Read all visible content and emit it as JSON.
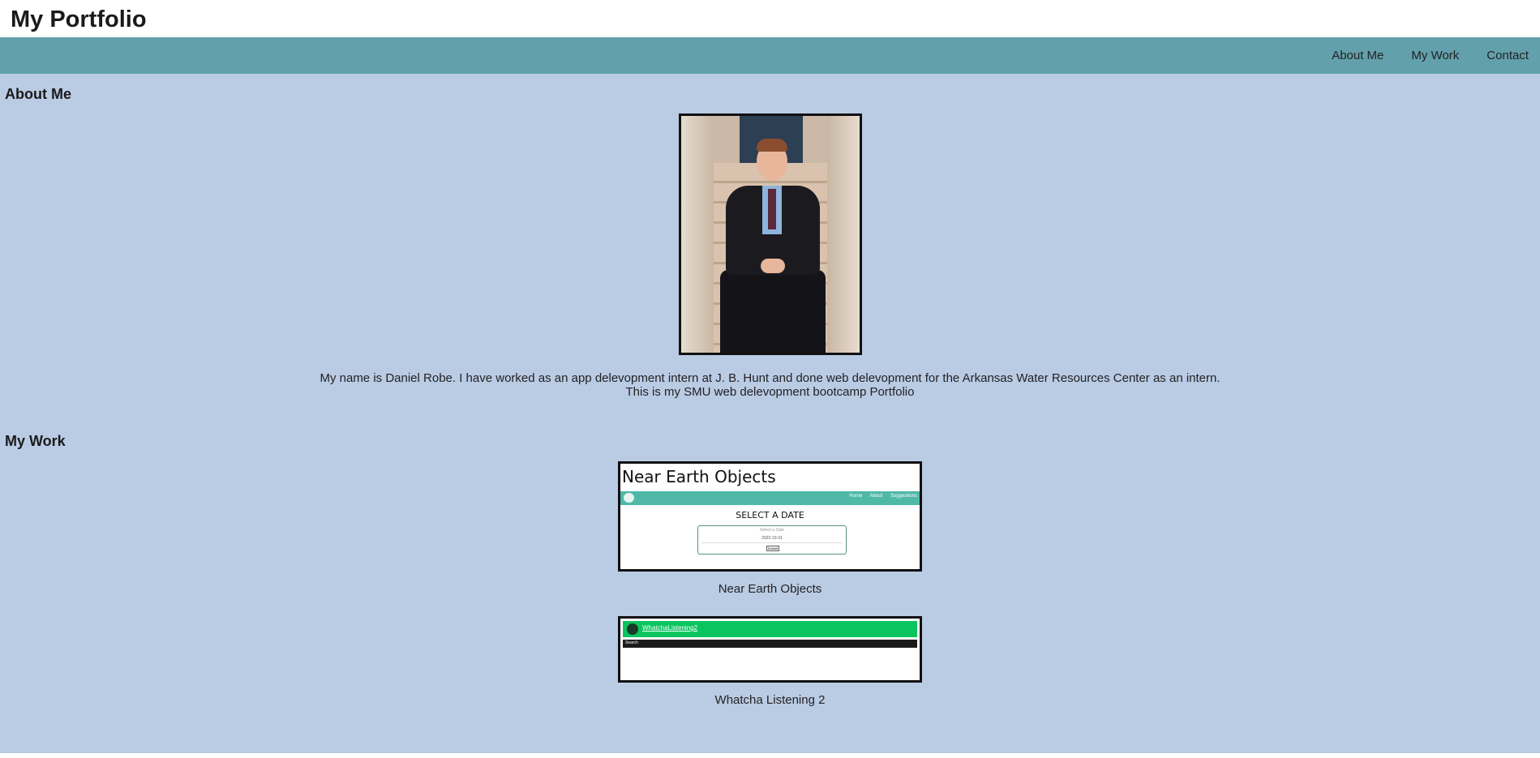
{
  "header": {
    "title": "My Portfolio"
  },
  "nav": {
    "items": [
      {
        "label": "About Me"
      },
      {
        "label": "My Work"
      },
      {
        "label": "Contact"
      }
    ]
  },
  "about": {
    "heading": "About Me",
    "text_line1": "My name is Daniel Robe. I have worked as an app delevopment intern at J. B. Hunt and done web delevopment for the Arkansas Water Resources Center as an intern.",
    "text_line2": "This is my SMU web delevopment bootcamp Portfolio"
  },
  "work": {
    "heading": "My Work",
    "projects": [
      {
        "caption": "Near Earth Objects",
        "thumb": {
          "title": "Near Earth Objects",
          "nav": "Home About Suggestions",
          "heading": "SELECT A DATE",
          "form_label": "Select a Date",
          "input_value": "2022-10-31",
          "button": "Submit"
        }
      },
      {
        "caption": "Whatcha Listening 2",
        "thumb": {
          "title": "WhatchaListening2",
          "bar_text": "Search"
        }
      }
    ]
  },
  "colors": {
    "navbar": "#62a0ac",
    "main_bg": "#bacbe4",
    "neo_teal": "#4fb8a7",
    "wl_green": "#0ac55f"
  }
}
